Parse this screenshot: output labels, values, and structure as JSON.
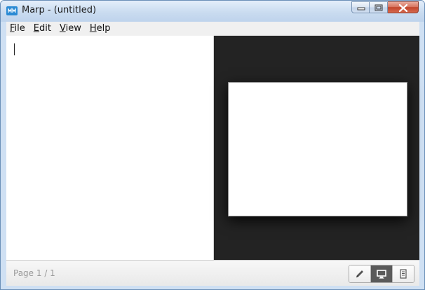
{
  "window": {
    "title": "Marp - (untitled)",
    "controls": {
      "minimize_icon": "minimize-icon",
      "maximize_icon": "restore-icon",
      "close_icon": "close-icon"
    }
  },
  "menu": {
    "items": [
      {
        "label_ul": "F",
        "label_rest": "ile"
      },
      {
        "label_ul": "E",
        "label_rest": "dit"
      },
      {
        "label_ul": "V",
        "label_rest": "iew"
      },
      {
        "label_ul": "H",
        "label_rest": "elp"
      }
    ]
  },
  "editor": {
    "content": ""
  },
  "status": {
    "page_indicator": "Page 1 / 1",
    "view_modes": [
      {
        "icon": "pencil-icon",
        "active": false
      },
      {
        "icon": "monitor-icon",
        "active": true
      },
      {
        "icon": "document-icon",
        "active": false
      }
    ]
  },
  "colors": {
    "preview_background": "#232323",
    "active_view_button": "#5a5a5a",
    "app_icon": "#2a8ad4"
  }
}
